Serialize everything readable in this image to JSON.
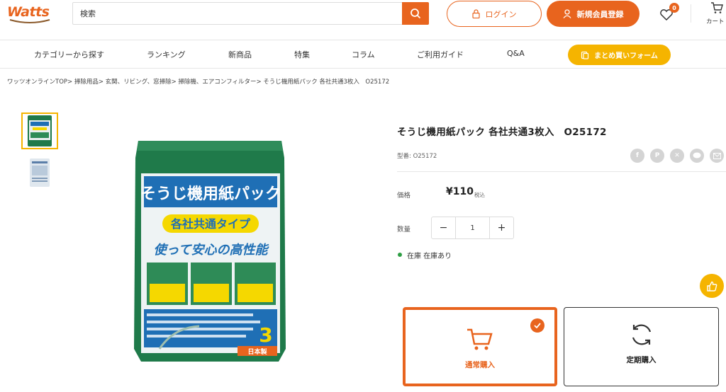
{
  "header": {
    "logo_text": "Watts",
    "search_placeholder": "検索",
    "login_label": "ログイン",
    "register_label": "新規会員登録",
    "wishlist_count": "0",
    "cart_label": "カート"
  },
  "nav": {
    "items": [
      "カテゴリーから探す",
      "ランキング",
      "新商品",
      "特集",
      "コラム",
      "ご利用ガイド",
      "Q&A"
    ],
    "bulk_order_label": "まとめ買いフォーム"
  },
  "breadcrumb": "ワッツオンラインTOP> 掃除用品> 玄関、リビング、窓掃除> 掃除機、エアコンフィルター> そうじ機用紙パック 各社共通3枚入　O25172",
  "product": {
    "title": "そうじ機用紙パック 各社共通3枚入　O25172",
    "sku": "型番: O25172",
    "price_label": "価格",
    "price": "¥110",
    "tax_label": "税込",
    "quantity_label": "数量",
    "quantity": "1",
    "stock_text": "在庫 在庫あり",
    "purchase_options": {
      "normal": "通常購入",
      "subscription": "定期購入"
    },
    "package_text": {
      "headline": "そうじ機用紙パック",
      "sub": "各社共通タイプ",
      "tagline": "使って安心の高性能",
      "count": "3",
      "made_in": "日本製"
    }
  },
  "colors": {
    "accent": "#e8641e",
    "yellow": "#f5b400",
    "in_stock": "#2e9e44",
    "package_green": "#1f7a4a"
  },
  "icons": [
    "search-icon",
    "lock-icon",
    "user-icon",
    "heart-icon",
    "cart-icon",
    "bulk-order-icon",
    "facebook-icon",
    "pinterest-icon",
    "x-icon",
    "line-icon",
    "mail-icon",
    "like-icon",
    "check-icon",
    "refresh-icon"
  ]
}
